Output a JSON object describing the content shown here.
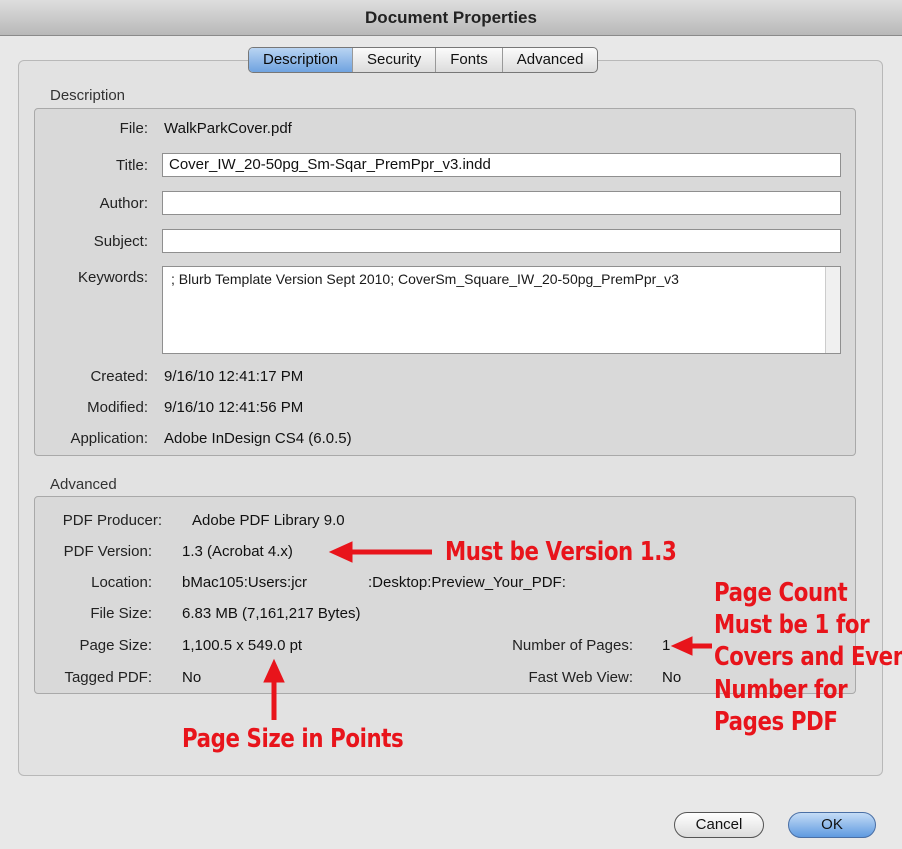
{
  "window": {
    "title": "Document Properties"
  },
  "tabs": [
    {
      "label": "Description",
      "active": true
    },
    {
      "label": "Security",
      "active": false
    },
    {
      "label": "Fonts",
      "active": false
    },
    {
      "label": "Advanced",
      "active": false
    }
  ],
  "description": {
    "section_title": "Description",
    "file_label": "File:",
    "file_value": "WalkParkCover.pdf",
    "title_label": "Title:",
    "title_value": "Cover_IW_20-50pg_Sm-Sqar_PremPpr_v3.indd",
    "author_label": "Author:",
    "author_value": "",
    "subject_label": "Subject:",
    "subject_value": "",
    "keywords_label": "Keywords:",
    "keywords_value": "; Blurb Template Version Sept 2010; CoverSm_Square_IW_20-50pg_PremPpr_v3",
    "created_label": "Created:",
    "created_value": "9/16/10 12:41:17 PM",
    "modified_label": "Modified:",
    "modified_value": "9/16/10 12:41:56 PM",
    "application_label": "Application:",
    "application_value": "Adobe InDesign CS4 (6.0.5)"
  },
  "advanced": {
    "section_title": "Advanced",
    "producer_label": "PDF Producer:",
    "producer_value": "Adobe PDF Library 9.0",
    "version_label": "PDF Version:",
    "version_value": "1.3 (Acrobat 4.x)",
    "location_label": "Location:",
    "location_value_a": "bMac105:Users:jcr",
    "location_value_b": ":Desktop:Preview_Your_PDF:",
    "filesize_label": "File Size:",
    "filesize_value": "6.83 MB (7,161,217 Bytes)",
    "pagesize_label": "Page Size:",
    "pagesize_value": "1,100.5 x 549.0 pt",
    "numpages_label": "Number of Pages:",
    "numpages_value": "1",
    "tagged_label": "Tagged PDF:",
    "tagged_value": "No",
    "fastweb_label": "Fast Web View:",
    "fastweb_value": "No"
  },
  "annotations": {
    "version_note": "Must be Version 1.3",
    "pagecount_lines": [
      "Page Count",
      "Must be 1 for",
      "Covers and Even",
      "Number for",
      "Pages PDF"
    ],
    "pagesize_note": "Page Size in Points",
    "color": "#e8141b"
  },
  "buttons": {
    "cancel_label": "Cancel",
    "ok_label": "OK"
  }
}
